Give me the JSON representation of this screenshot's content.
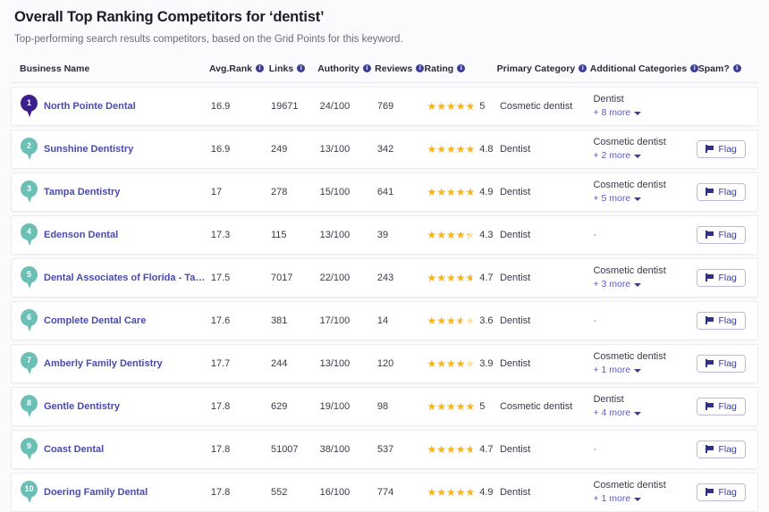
{
  "header": {
    "title": "Overall Top Ranking Competitors for ‘dentist’",
    "subtitle": "Top-performing search results competitors, based on the Grid Points for this keyword."
  },
  "colors": {
    "rank_one_pin": "#3b1e8e",
    "pin_teal": "#6bbfb5",
    "link": "#4a4ab0",
    "star_filled": "#f5b325",
    "star_empty": "#fbe3a9",
    "info_icon": "#3b3b98",
    "flag_border": "#b9b9e0",
    "page_bg": "#fbfbfd"
  },
  "table": {
    "columns": [
      {
        "key": "name",
        "label": "Business Name",
        "info": false
      },
      {
        "key": "rank",
        "label": "Avg.Rank",
        "info": true
      },
      {
        "key": "links",
        "label": "Links",
        "info": true
      },
      {
        "key": "auth",
        "label": "Authority",
        "info": true
      },
      {
        "key": "rev",
        "label": "Reviews",
        "info": true
      },
      {
        "key": "rating",
        "label": "Rating",
        "info": true
      },
      {
        "key": "pcat",
        "label": "Primary Category",
        "info": true
      },
      {
        "key": "acat",
        "label": "Additional Categories",
        "info": true
      },
      {
        "key": "spam",
        "label": "Spam?",
        "info": true
      }
    ],
    "rows": [
      {
        "rank_badge": "1",
        "pin_color": "#3b1e8e",
        "name": "North Pointe Dental",
        "avg_rank": "16.9",
        "links": "19671",
        "authority": "24/100",
        "reviews": "769",
        "rating_value": "5",
        "rating_num": 5,
        "primary_category": "Cosmetic dentist",
        "additional_main": "Dentist",
        "additional_more": "+ 8 more",
        "flag_label": null
      },
      {
        "rank_badge": "2",
        "pin_color": "#6bbfb5",
        "name": "Sunshine Dentistry",
        "avg_rank": "16.9",
        "links": "249",
        "authority": "13/100",
        "reviews": "342",
        "rating_value": "4.8",
        "rating_num": 4.8,
        "primary_category": "Dentist",
        "additional_main": "Cosmetic dentist",
        "additional_more": "+ 2 more",
        "flag_label": "Flag"
      },
      {
        "rank_badge": "3",
        "pin_color": "#6bbfb5",
        "name": "Tampa Dentistry",
        "avg_rank": "17",
        "links": "278",
        "authority": "15/100",
        "reviews": "641",
        "rating_value": "4.9",
        "rating_num": 4.9,
        "primary_category": "Dentist",
        "additional_main": "Cosmetic dentist",
        "additional_more": "+ 5 more",
        "flag_label": "Flag"
      },
      {
        "rank_badge": "4",
        "pin_color": "#6bbfb5",
        "name": "Edenson Dental",
        "avg_rank": "17.3",
        "links": "115",
        "authority": "13/100",
        "reviews": "39",
        "rating_value": "4.3",
        "rating_num": 4.3,
        "primary_category": "Dentist",
        "additional_main": "-",
        "additional_more": null,
        "flag_label": "Flag"
      },
      {
        "rank_badge": "5",
        "pin_color": "#6bbfb5",
        "name": "Dental Associates of Florida - Tampa",
        "avg_rank": "17.5",
        "links": "7017",
        "authority": "22/100",
        "reviews": "243",
        "rating_value": "4.7",
        "rating_num": 4.7,
        "primary_category": "Dentist",
        "additional_main": "Cosmetic dentist",
        "additional_more": "+ 3 more",
        "flag_label": "Flag"
      },
      {
        "rank_badge": "6",
        "pin_color": "#6bbfb5",
        "name": "Complete Dental Care",
        "avg_rank": "17.6",
        "links": "381",
        "authority": "17/100",
        "reviews": "14",
        "rating_value": "3.6",
        "rating_num": 3.6,
        "primary_category": "Dentist",
        "additional_main": "-",
        "additional_more": null,
        "flag_label": "Flag"
      },
      {
        "rank_badge": "7",
        "pin_color": "#6bbfb5",
        "name": "Amberly Family Dentistry",
        "avg_rank": "17.7",
        "links": "244",
        "authority": "13/100",
        "reviews": "120",
        "rating_value": "3.9",
        "rating_num": 3.9,
        "primary_category": "Dentist",
        "additional_main": "Cosmetic dentist",
        "additional_more": "+ 1 more",
        "flag_label": "Flag"
      },
      {
        "rank_badge": "8",
        "pin_color": "#6bbfb5",
        "name": "Gentle Dentistry",
        "avg_rank": "17.8",
        "links": "629",
        "authority": "19/100",
        "reviews": "98",
        "rating_value": "5",
        "rating_num": 5,
        "primary_category": "Cosmetic dentist",
        "additional_main": "Dentist",
        "additional_more": "+ 4 more",
        "flag_label": "Flag"
      },
      {
        "rank_badge": "9",
        "pin_color": "#6bbfb5",
        "name": "Coast Dental",
        "avg_rank": "17.8",
        "links": "51007",
        "authority": "38/100",
        "reviews": "537",
        "rating_value": "4.7",
        "rating_num": 4.7,
        "primary_category": "Dentist",
        "additional_main": "-",
        "additional_more": null,
        "flag_label": "Flag"
      },
      {
        "rank_badge": "10",
        "pin_color": "#6bbfb5",
        "name": "Doering Family Dental",
        "avg_rank": "17.8",
        "links": "552",
        "authority": "16/100",
        "reviews": "774",
        "rating_value": "4.9",
        "rating_num": 4.9,
        "primary_category": "Dentist",
        "additional_main": "Cosmetic dentist",
        "additional_more": "+ 1 more",
        "flag_label": "Flag"
      }
    ]
  }
}
